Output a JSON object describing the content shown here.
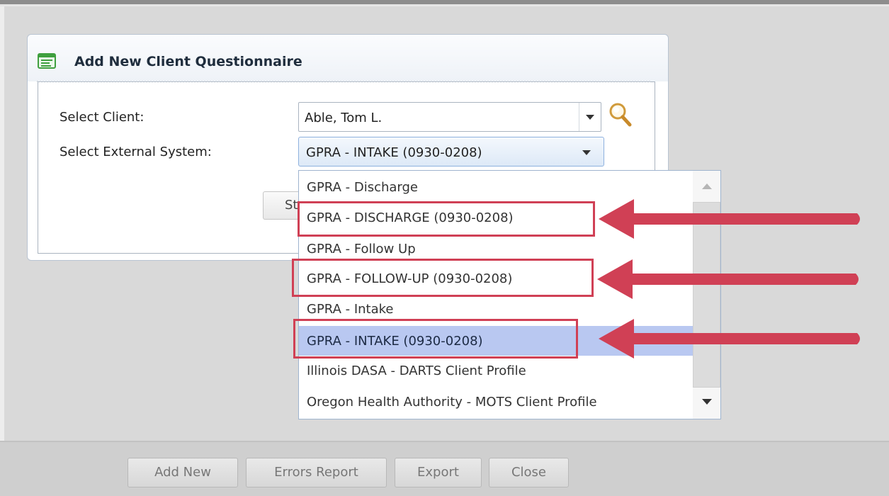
{
  "dialog": {
    "title": "Add New Client Questionnaire",
    "select_client_label": "Select Client:",
    "select_client_value": "Able, Tom L.",
    "select_system_label": "Select External System:",
    "select_system_value": "GPRA - INTAKE (0930-0208)",
    "start_button_label_partial": "St"
  },
  "dropdown": {
    "items": [
      "GPRA - Discharge",
      "GPRA - DISCHARGE (0930-0208)",
      "GPRA - Follow Up",
      "GPRA - FOLLOW-UP (0930-0208)",
      "GPRA - Intake",
      "GPRA - INTAKE (0930-0208)",
      "Illinois DASA - DARTS Client Profile",
      "Oregon Health Authority - MOTS Client Profile"
    ],
    "selected_item": "GPRA - INTAKE (0930-0208)"
  },
  "footer": {
    "add_new": "Add New",
    "errors_report": "Errors Report",
    "export": "Export",
    "close": "Close"
  },
  "icons": {
    "panel": "form-icon",
    "search": "magnifier-icon",
    "dropdown": "chevron-down-icon"
  },
  "colors": {
    "highlight": "#d04055",
    "selected_row": "#b9c8f1"
  }
}
